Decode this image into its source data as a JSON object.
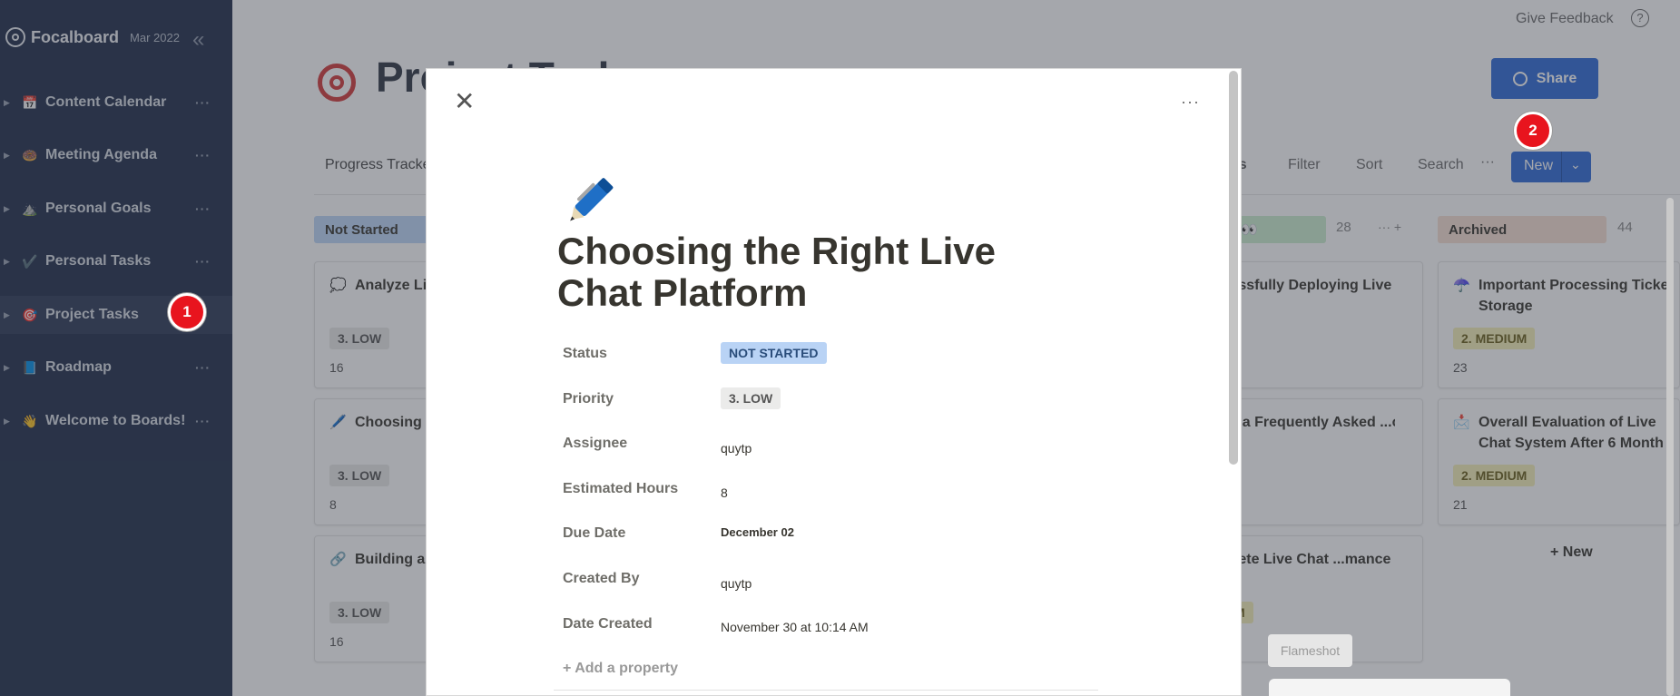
{
  "sidebar": {
    "brand": "Focalboard",
    "version": "Mar 2022",
    "items": [
      {
        "label": "Content Calendar",
        "emoji": "📅"
      },
      {
        "label": "Meeting Agenda",
        "emoji": "🍩"
      },
      {
        "label": "Personal Goals",
        "emoji": "⛰️"
      },
      {
        "label": "Personal Tasks",
        "emoji": "✔️"
      },
      {
        "label": "Project Tasks",
        "emoji": "🎯"
      },
      {
        "label": "Roadmap",
        "emoji": "📘"
      },
      {
        "label": "Welcome to Boards!",
        "emoji": "👋"
      }
    ],
    "more_glyph": "···"
  },
  "header": {
    "give_feedback": "Give Feedback",
    "help": "?",
    "board_title": "Project Tasks",
    "share_label": "Share"
  },
  "toolbar": {
    "view_tab": "Progress Tracker",
    "group_by": "us",
    "filter": "Filter",
    "sort": "Sort",
    "search": "Search",
    "more": "···",
    "new_label": "New",
    "new_chevron": "⌄"
  },
  "columns": [
    {
      "label": "Not Started",
      "color": "#bdd7f7"
    },
    {
      "label": "👀",
      "count": "28",
      "color": "#cdeed0"
    },
    {
      "label": "Archived",
      "count": "44",
      "color": "#f7e1d3"
    }
  ],
  "cards": [
    {
      "emoji": "💭",
      "title": "Analyze Li... Requireme...",
      "badge": "3. LOW",
      "num": "16"
    },
    {
      "emoji": "🖊️",
      "title": "Choosing ... Platform",
      "badge": "3. LOW",
      "num": "8"
    },
    {
      "emoji": "🔗",
      "title": "Building a... Process",
      "badge": "3. LOW",
      "num": "16"
    },
    {
      "title": "...ssfully Deploying Live"
    },
    {
      "title": "... a Frequently Asked ...ons (FAQ) Library"
    },
    {
      "title": "...ete Live Chat ...mance Report",
      "badge": "M"
    },
    {
      "emoji": "☂️",
      "title": "Important Processing Ticket Storage",
      "badge": "2. MEDIUM",
      "num": "23"
    },
    {
      "emoji": "📩",
      "title": "Overall Evaluation of Live Chat System After 6 Month",
      "badge": "2. MEDIUM",
      "num": "21"
    }
  ],
  "add_new": "+ New",
  "modal": {
    "close_glyph": "✕",
    "more_glyph": "···",
    "title": "Choosing the Right Live Chat Platform",
    "properties": [
      {
        "label": "Status",
        "value": "NOT STARTED"
      },
      {
        "label": "Priority",
        "value": "3. LOW"
      },
      {
        "label": "Assignee",
        "value": "quytp"
      },
      {
        "label": "Estimated Hours",
        "value": "8"
      },
      {
        "label": "Due Date",
        "value": "December 02"
      },
      {
        "label": "Created By",
        "value": "quytp"
      },
      {
        "label": "Date Created",
        "value": "November 30 at 10:14 AM"
      }
    ],
    "add_property": "+ Add a property"
  },
  "flameshot": "Flameshot",
  "markers": [
    "1",
    "2"
  ]
}
